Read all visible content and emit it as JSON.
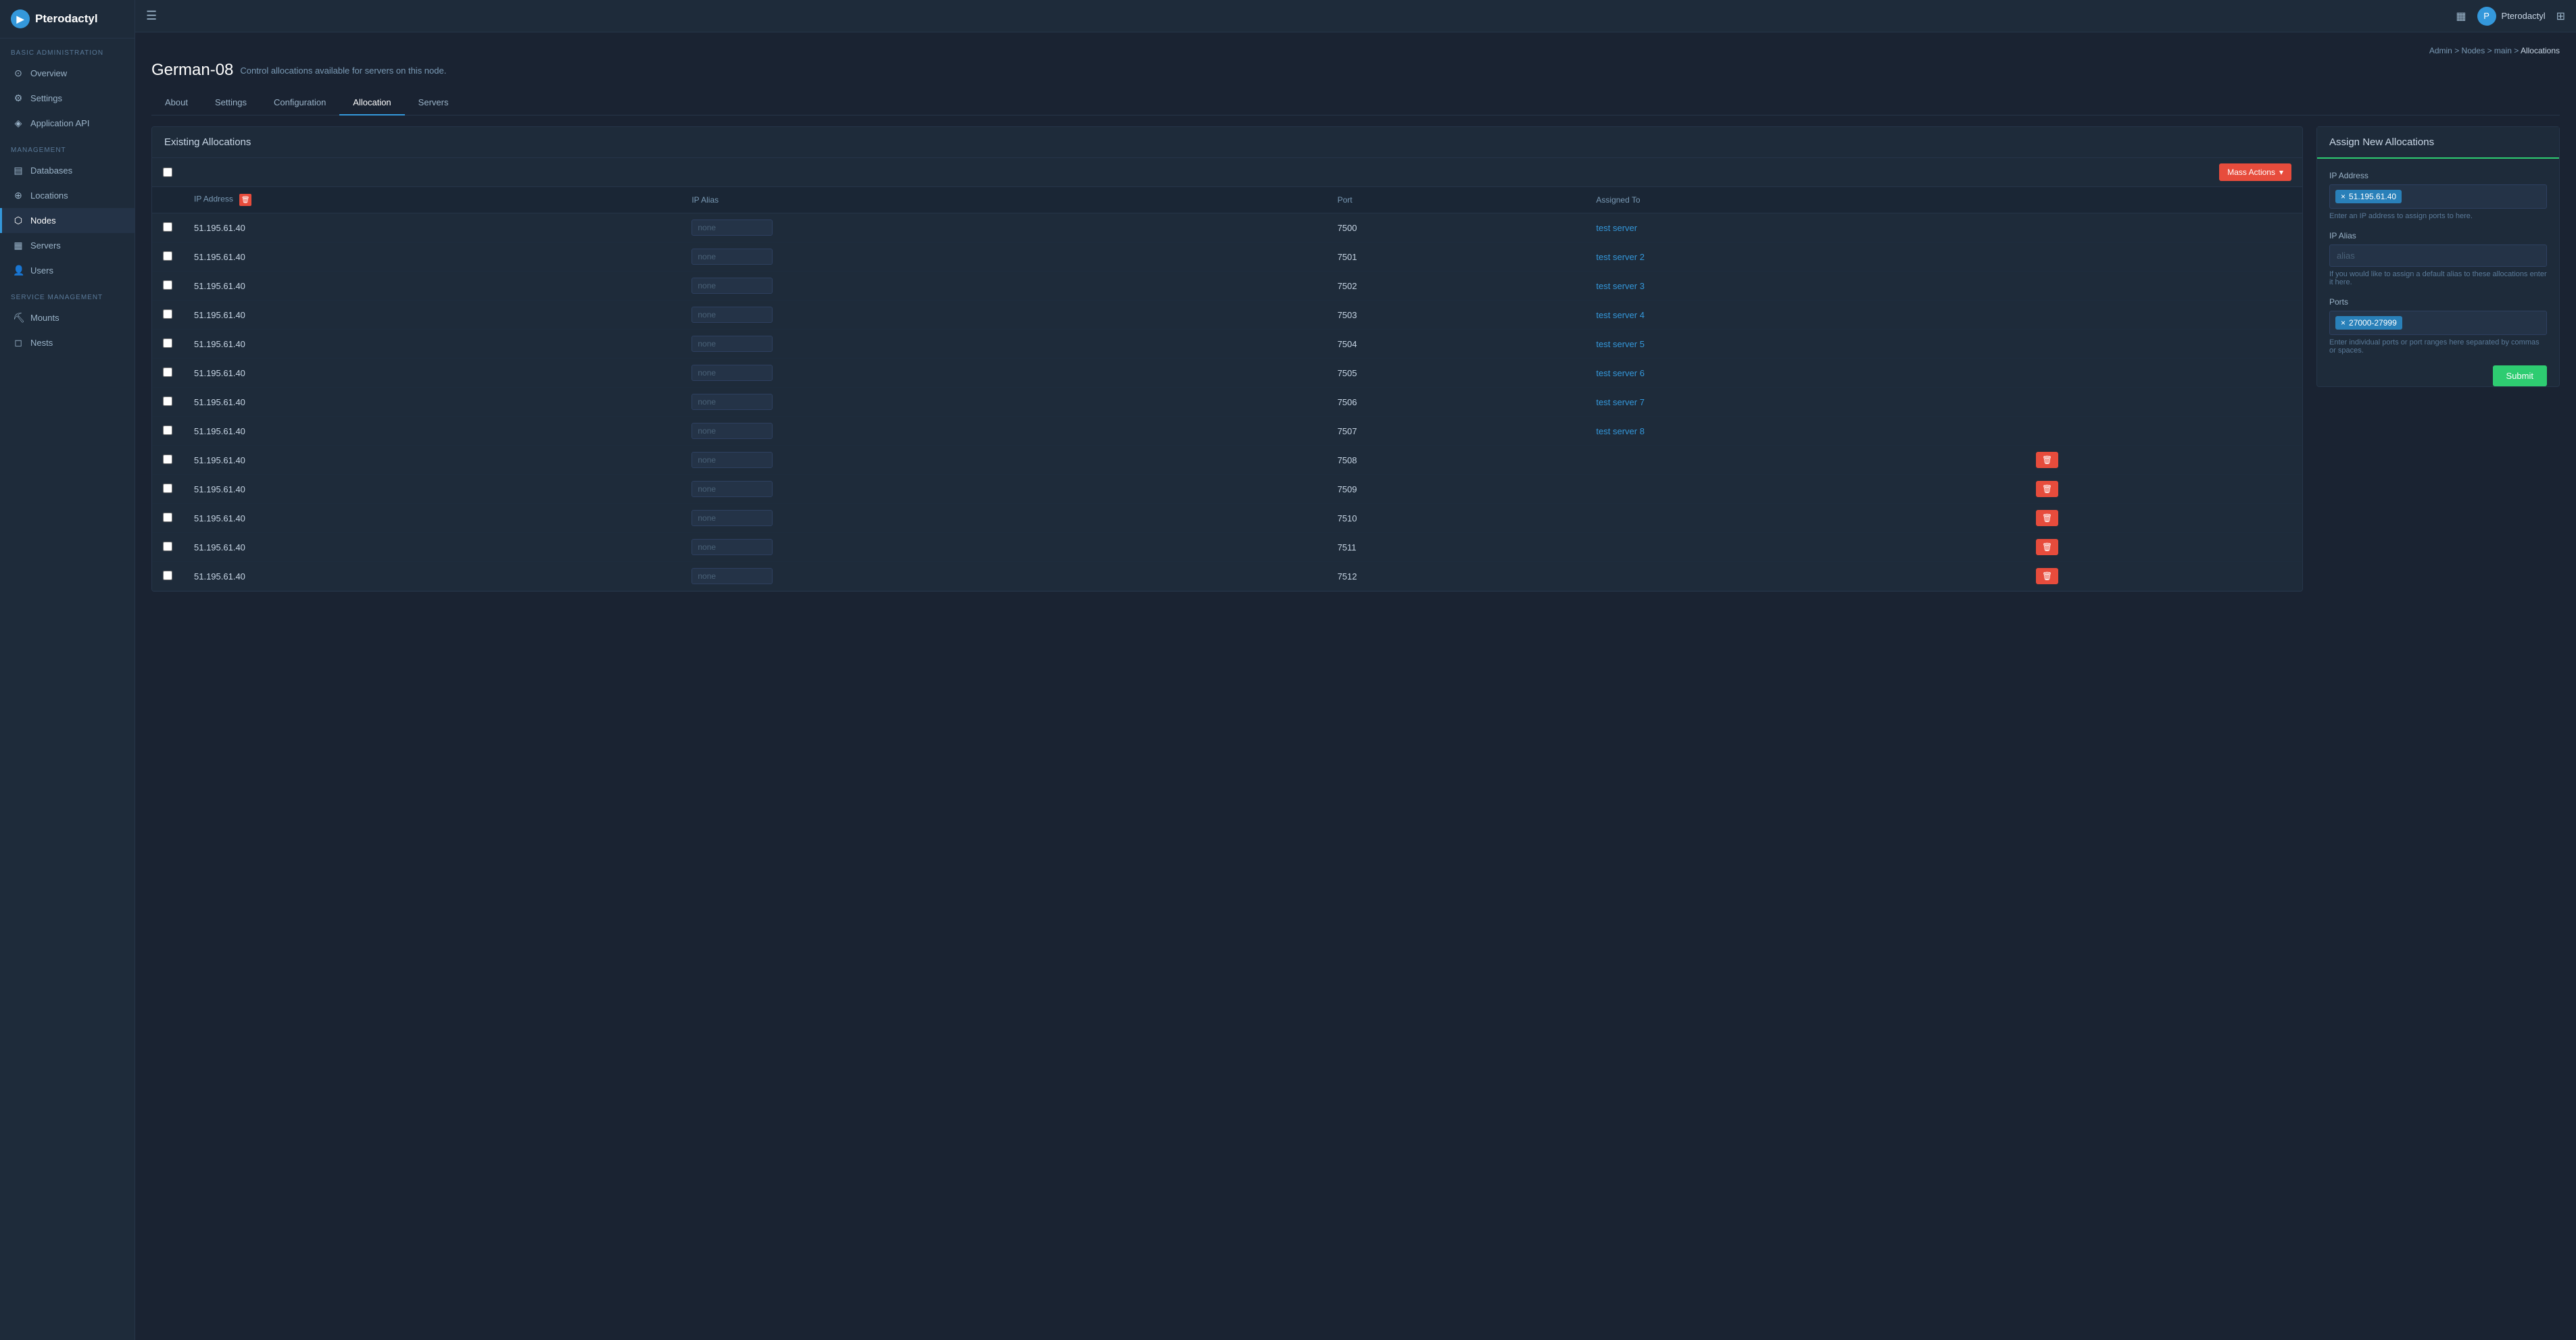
{
  "app": {
    "name": "Pterodactyl"
  },
  "topbar": {
    "hamburger_label": "☰",
    "user_name": "Pterodactyl",
    "user_initial": "P",
    "grid_icon": "▦",
    "bell_icon": "🔔"
  },
  "breadcrumb": {
    "admin_label": "Admin",
    "nodes_label": "Nodes",
    "main_label": "main",
    "current_label": "Allocations"
  },
  "sidebar": {
    "basic_admin_label": "Basic Administration",
    "overview_label": "Overview",
    "settings_label": "Settings",
    "api_label": "Application API",
    "management_label": "Management",
    "databases_label": "Databases",
    "locations_label": "Locations",
    "nodes_label": "Nodes",
    "servers_label": "Servers",
    "users_label": "Users",
    "service_mgmt_label": "Service Management",
    "mounts_label": "Mounts",
    "nests_label": "Nests"
  },
  "page": {
    "node_name": "German-08",
    "subtitle": "Control allocations available for servers on this node."
  },
  "tabs": [
    {
      "label": "About",
      "active": false
    },
    {
      "label": "Settings",
      "active": false
    },
    {
      "label": "Configuration",
      "active": false
    },
    {
      "label": "Allocation",
      "active": true
    },
    {
      "label": "Servers",
      "active": false
    }
  ],
  "existing_allocations": {
    "title": "Existing Allocations",
    "mass_actions_label": "Mass Actions",
    "columns": {
      "checkbox": "",
      "ip_address": "IP Address",
      "ip_alias": "IP Alias",
      "port": "Port",
      "assigned_to": "Assigned To"
    },
    "rows": [
      {
        "ip": "51.195.61.40",
        "alias_placeholder": "none",
        "port": "7500",
        "assigned_to": "test server",
        "assigned_link": true,
        "show_delete": false
      },
      {
        "ip": "51.195.61.40",
        "alias_placeholder": "none",
        "port": "7501",
        "assigned_to": "test server 2",
        "assigned_link": true,
        "show_delete": false
      },
      {
        "ip": "51.195.61.40",
        "alias_placeholder": "none",
        "port": "7502",
        "assigned_to": "test server 3",
        "assigned_link": true,
        "show_delete": false
      },
      {
        "ip": "51.195.61.40",
        "alias_placeholder": "none",
        "port": "7503",
        "assigned_to": "test server 4",
        "assigned_link": true,
        "show_delete": false
      },
      {
        "ip": "51.195.61.40",
        "alias_placeholder": "none",
        "port": "7504",
        "assigned_to": "test server 5",
        "assigned_link": true,
        "show_delete": false
      },
      {
        "ip": "51.195.61.40",
        "alias_placeholder": "none",
        "port": "7505",
        "assigned_to": "test server 6",
        "assigned_link": true,
        "show_delete": false
      },
      {
        "ip": "51.195.61.40",
        "alias_placeholder": "none",
        "port": "7506",
        "assigned_to": "test server 7",
        "assigned_link": true,
        "show_delete": false
      },
      {
        "ip": "51.195.61.40",
        "alias_placeholder": "none",
        "port": "7507",
        "assigned_to": "test server 8",
        "assigned_link": true,
        "show_delete": false
      },
      {
        "ip": "51.195.61.40",
        "alias_placeholder": "none",
        "port": "7508",
        "assigned_to": "",
        "assigned_link": false,
        "show_delete": true
      },
      {
        "ip": "51.195.61.40",
        "alias_placeholder": "none",
        "port": "7509",
        "assigned_to": "",
        "assigned_link": false,
        "show_delete": true
      },
      {
        "ip": "51.195.61.40",
        "alias_placeholder": "none",
        "port": "7510",
        "assigned_to": "",
        "assigned_link": false,
        "show_delete": true
      },
      {
        "ip": "51.195.61.40",
        "alias_placeholder": "none",
        "port": "7511",
        "assigned_to": "",
        "assigned_link": false,
        "show_delete": true
      },
      {
        "ip": "51.195.61.40",
        "alias_placeholder": "none",
        "port": "7512",
        "assigned_to": "",
        "assigned_link": false,
        "show_delete": true
      }
    ]
  },
  "assign_new": {
    "title": "Assign New Allocations",
    "ip_address_label": "IP Address",
    "ip_tag": "51.195.61.40",
    "ip_help": "Enter an IP address to assign ports to here.",
    "ip_alias_label": "IP Alias",
    "ip_alias_placeholder": "alias",
    "ip_alias_help": "If you would like to assign a default alias to these allocations enter it here.",
    "ports_label": "Ports",
    "ports_tag": "27000-27999",
    "ports_help": "Enter individual ports or port ranges here separated by commas or spaces.",
    "submit_label": "Submit"
  }
}
